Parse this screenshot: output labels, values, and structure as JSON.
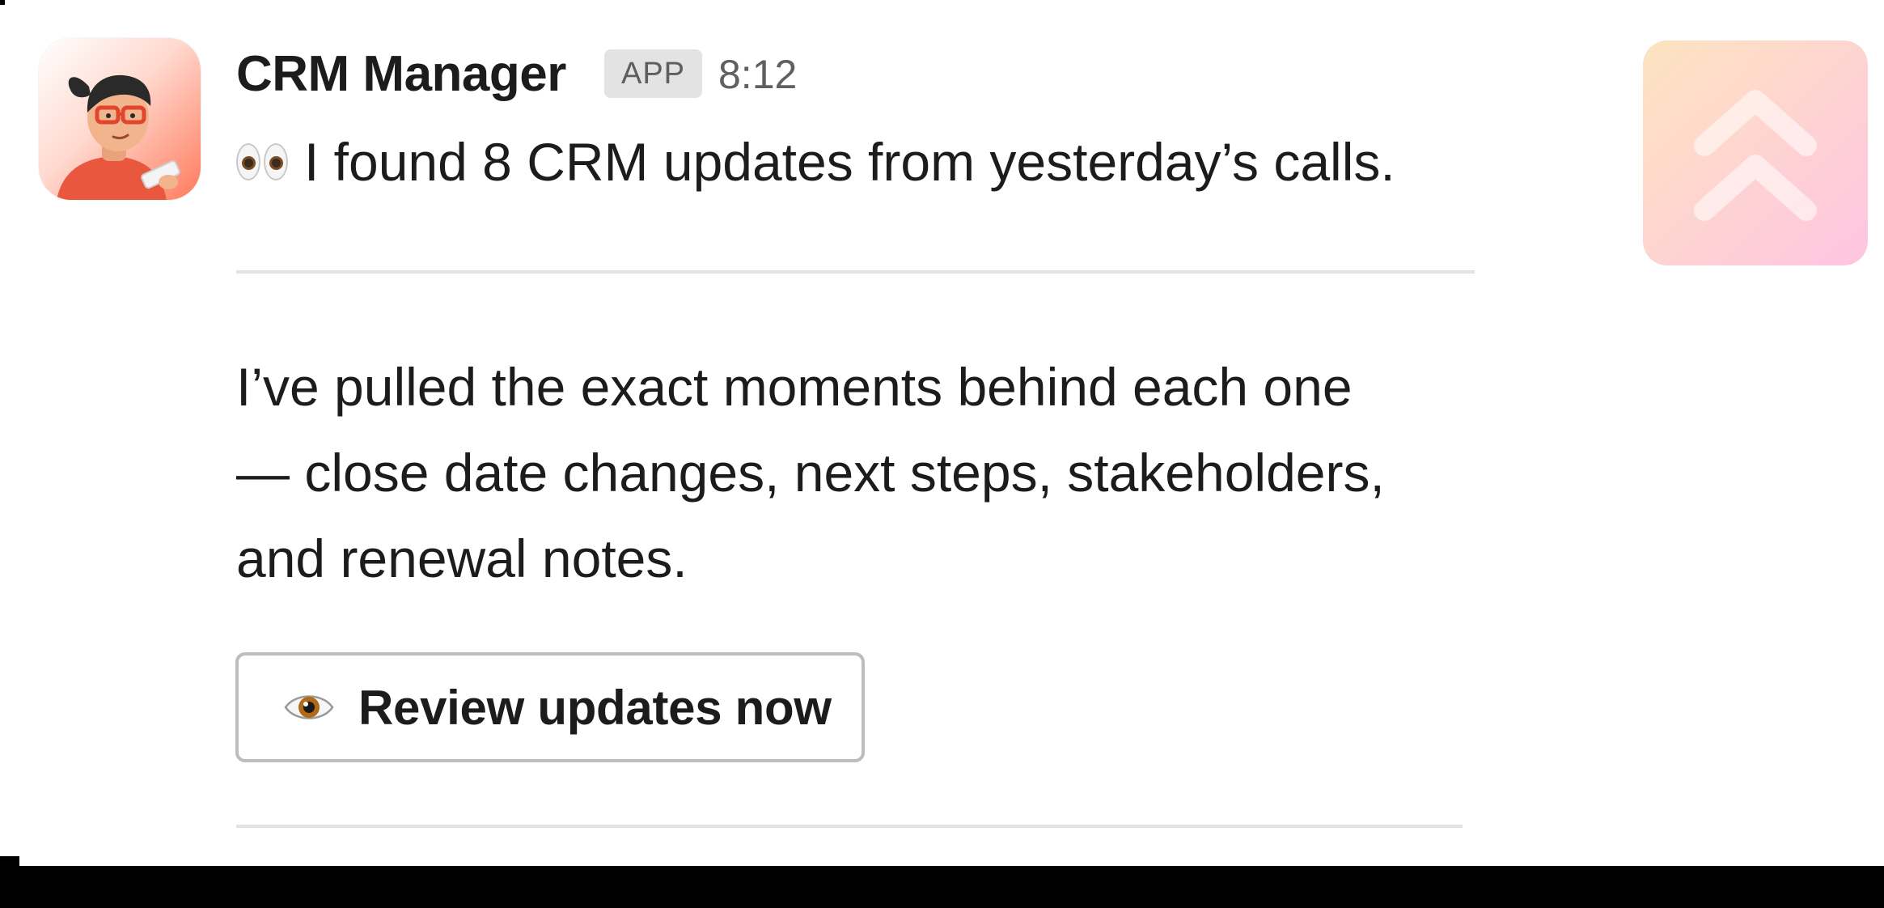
{
  "message": {
    "sender": "CRM Manager",
    "badge": "APP",
    "time": "8:12",
    "intro_emoji": "eyes-emoji",
    "intro": "I found 8 CRM updates from yesterday’s calls.",
    "body_lines": [
      "I’ve pulled the exact moments behind each one",
      "— close date changes, next steps, stakeholders,",
      "and renewal notes."
    ],
    "button": {
      "icon": "eye-emoji",
      "label": "Review updates now"
    }
  },
  "avatar": {
    "icon": "crm-manager-avatar"
  },
  "side_tile": {
    "icon": "double-chevron-up-icon"
  },
  "colors": {
    "text": "#1d1c1d",
    "muted": "#616061",
    "badge_bg": "#e3e3e3",
    "button_border": "#bdbdbd",
    "tile_gradient_start": "#fde4c0",
    "tile_gradient_end": "#ffc4e2"
  }
}
